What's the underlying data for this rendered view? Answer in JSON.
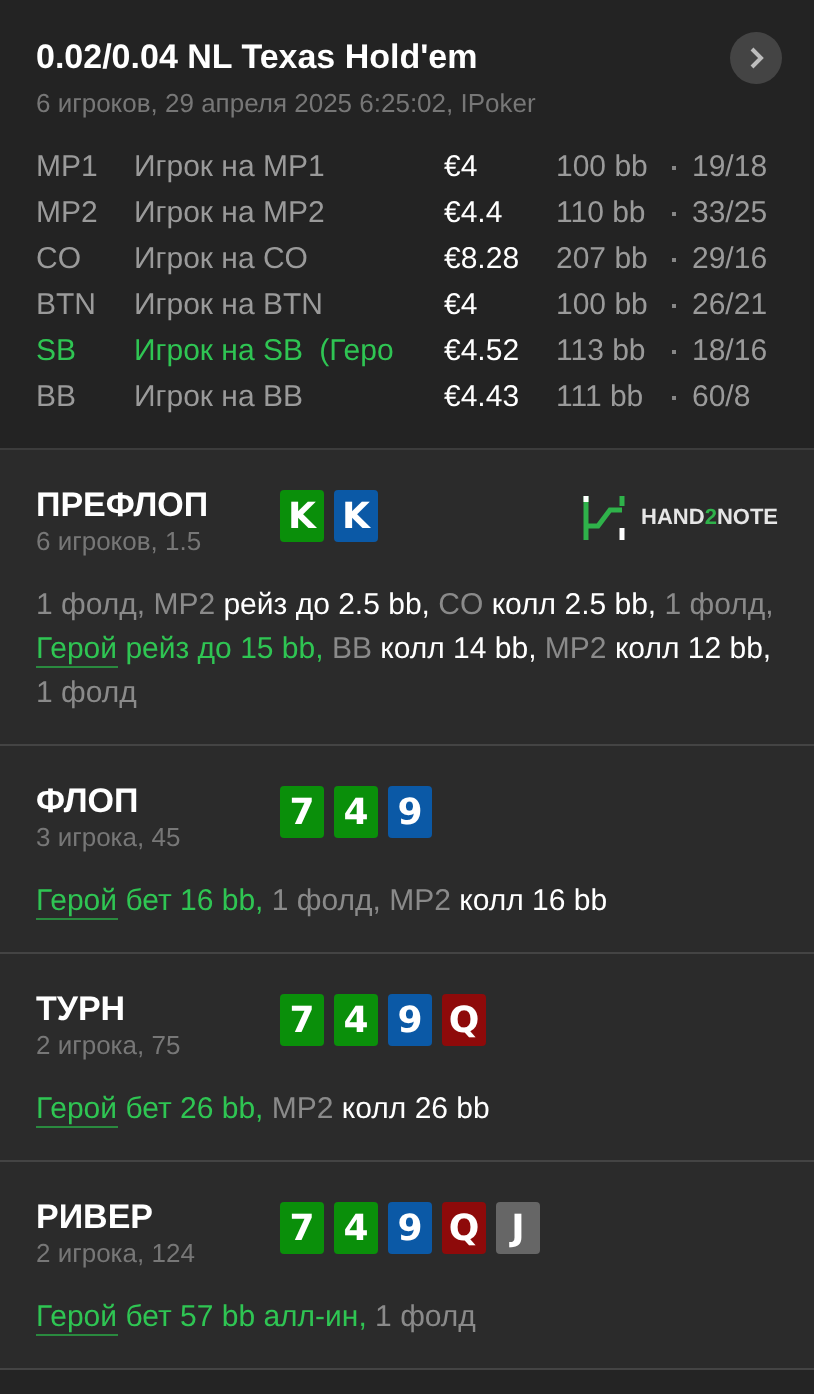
{
  "header": {
    "title": "0.02/0.04 NL Texas Hold'em",
    "subtitle": "6 игроков, 29 апреля 2025 6:25:02, IPoker"
  },
  "players": [
    {
      "position": "MP1",
      "name": "Игрок на MP1",
      "hero": false,
      "stack": "€4",
      "bb": "100 bb",
      "stats": "19/18"
    },
    {
      "position": "MP2",
      "name": "Игрок на MP2",
      "hero": false,
      "stack": "€4.4",
      "bb": "110 bb",
      "stats": "33/25"
    },
    {
      "position": "CO",
      "name": "Игрок на CO",
      "hero": false,
      "stack": "€8.28",
      "bb": "207 bb",
      "stats": "29/16"
    },
    {
      "position": "BTN",
      "name": "Игрок на BTN",
      "hero": false,
      "stack": "€4",
      "bb": "100 bb",
      "stats": "26/21"
    },
    {
      "position": "SB",
      "name": "Игрок на SB",
      "tag": "(Геро",
      "hero": true,
      "stack": "€4.52",
      "bb": "113 bb",
      "stats": "18/16"
    },
    {
      "position": "BB",
      "name": "Игрок на BB",
      "hero": false,
      "stack": "€4.43",
      "bb": "111 bb",
      "stats": "60/8"
    }
  ],
  "logo": {
    "prefix": "HAND",
    "accent": "2",
    "suffix": "NOTE"
  },
  "streets": [
    {
      "name": "ПРЕФЛОП",
      "info": "6 игроков, 1.5",
      "cards": [
        {
          "rank": "K",
          "color": "#0a8f0a"
        },
        {
          "rank": "K",
          "color": "#0b59a6"
        }
      ],
      "actions": [
        {
          "kind": "muted",
          "text": "1 фолд, MP2 "
        },
        {
          "kind": "bright",
          "text": "рейз до 2.5 bb,"
        },
        {
          "kind": "muted",
          "text": " CO "
        },
        {
          "kind": "bright",
          "text": "колл 2.5 bb,"
        },
        {
          "kind": "muted",
          "text": " 1 фолд, "
        },
        {
          "kind": "hero_link",
          "text": "Герой"
        },
        {
          "kind": "hero",
          "text": " рейз до 15 bb,"
        },
        {
          "kind": "muted",
          "text": " BB "
        },
        {
          "kind": "bright",
          "text": "колл 14 bb,"
        },
        {
          "kind": "muted",
          "text": " MP2 "
        },
        {
          "kind": "bright",
          "text": "колл 12 bb,"
        },
        {
          "kind": "muted",
          "text": " 1 фолд"
        }
      ]
    },
    {
      "name": "ФЛОП",
      "info": "3 игрока, 45",
      "cards": [
        {
          "rank": "7",
          "color": "#0a8f0a"
        },
        {
          "rank": "4",
          "color": "#0a8f0a"
        },
        {
          "rank": "9",
          "color": "#0b59a6"
        }
      ],
      "actions": [
        {
          "kind": "hero_link",
          "text": "Герой"
        },
        {
          "kind": "hero",
          "text": " бет 16 bb,"
        },
        {
          "kind": "muted",
          "text": " 1 фолд, MP2 "
        },
        {
          "kind": "bright",
          "text": "колл 16 bb"
        }
      ]
    },
    {
      "name": "ТУРН",
      "info": "2 игрока, 75",
      "cards": [
        {
          "rank": "7",
          "color": "#0a8f0a"
        },
        {
          "rank": "4",
          "color": "#0a8f0a"
        },
        {
          "rank": "9",
          "color": "#0b59a6"
        },
        {
          "rank": "Q",
          "color": "#8e0a0a"
        }
      ],
      "actions": [
        {
          "kind": "hero_link",
          "text": "Герой"
        },
        {
          "kind": "hero",
          "text": " бет 26 bb,"
        },
        {
          "kind": "muted",
          "text": " MP2 "
        },
        {
          "kind": "bright",
          "text": "колл 26 bb"
        }
      ]
    },
    {
      "name": "РИВЕР",
      "info": "2 игрока, 124",
      "cards": [
        {
          "rank": "7",
          "color": "#0a8f0a"
        },
        {
          "rank": "4",
          "color": "#0a8f0a"
        },
        {
          "rank": "9",
          "color": "#0b59a6"
        },
        {
          "rank": "Q",
          "color": "#8e0a0a"
        },
        {
          "rank": "J",
          "color": "#666666"
        }
      ],
      "actions": [
        {
          "kind": "hero_link",
          "text": "Герой"
        },
        {
          "kind": "hero",
          "text": " бет 57 bb алл-ин,"
        },
        {
          "kind": "muted",
          "text": " 1 фолд"
        }
      ]
    }
  ]
}
